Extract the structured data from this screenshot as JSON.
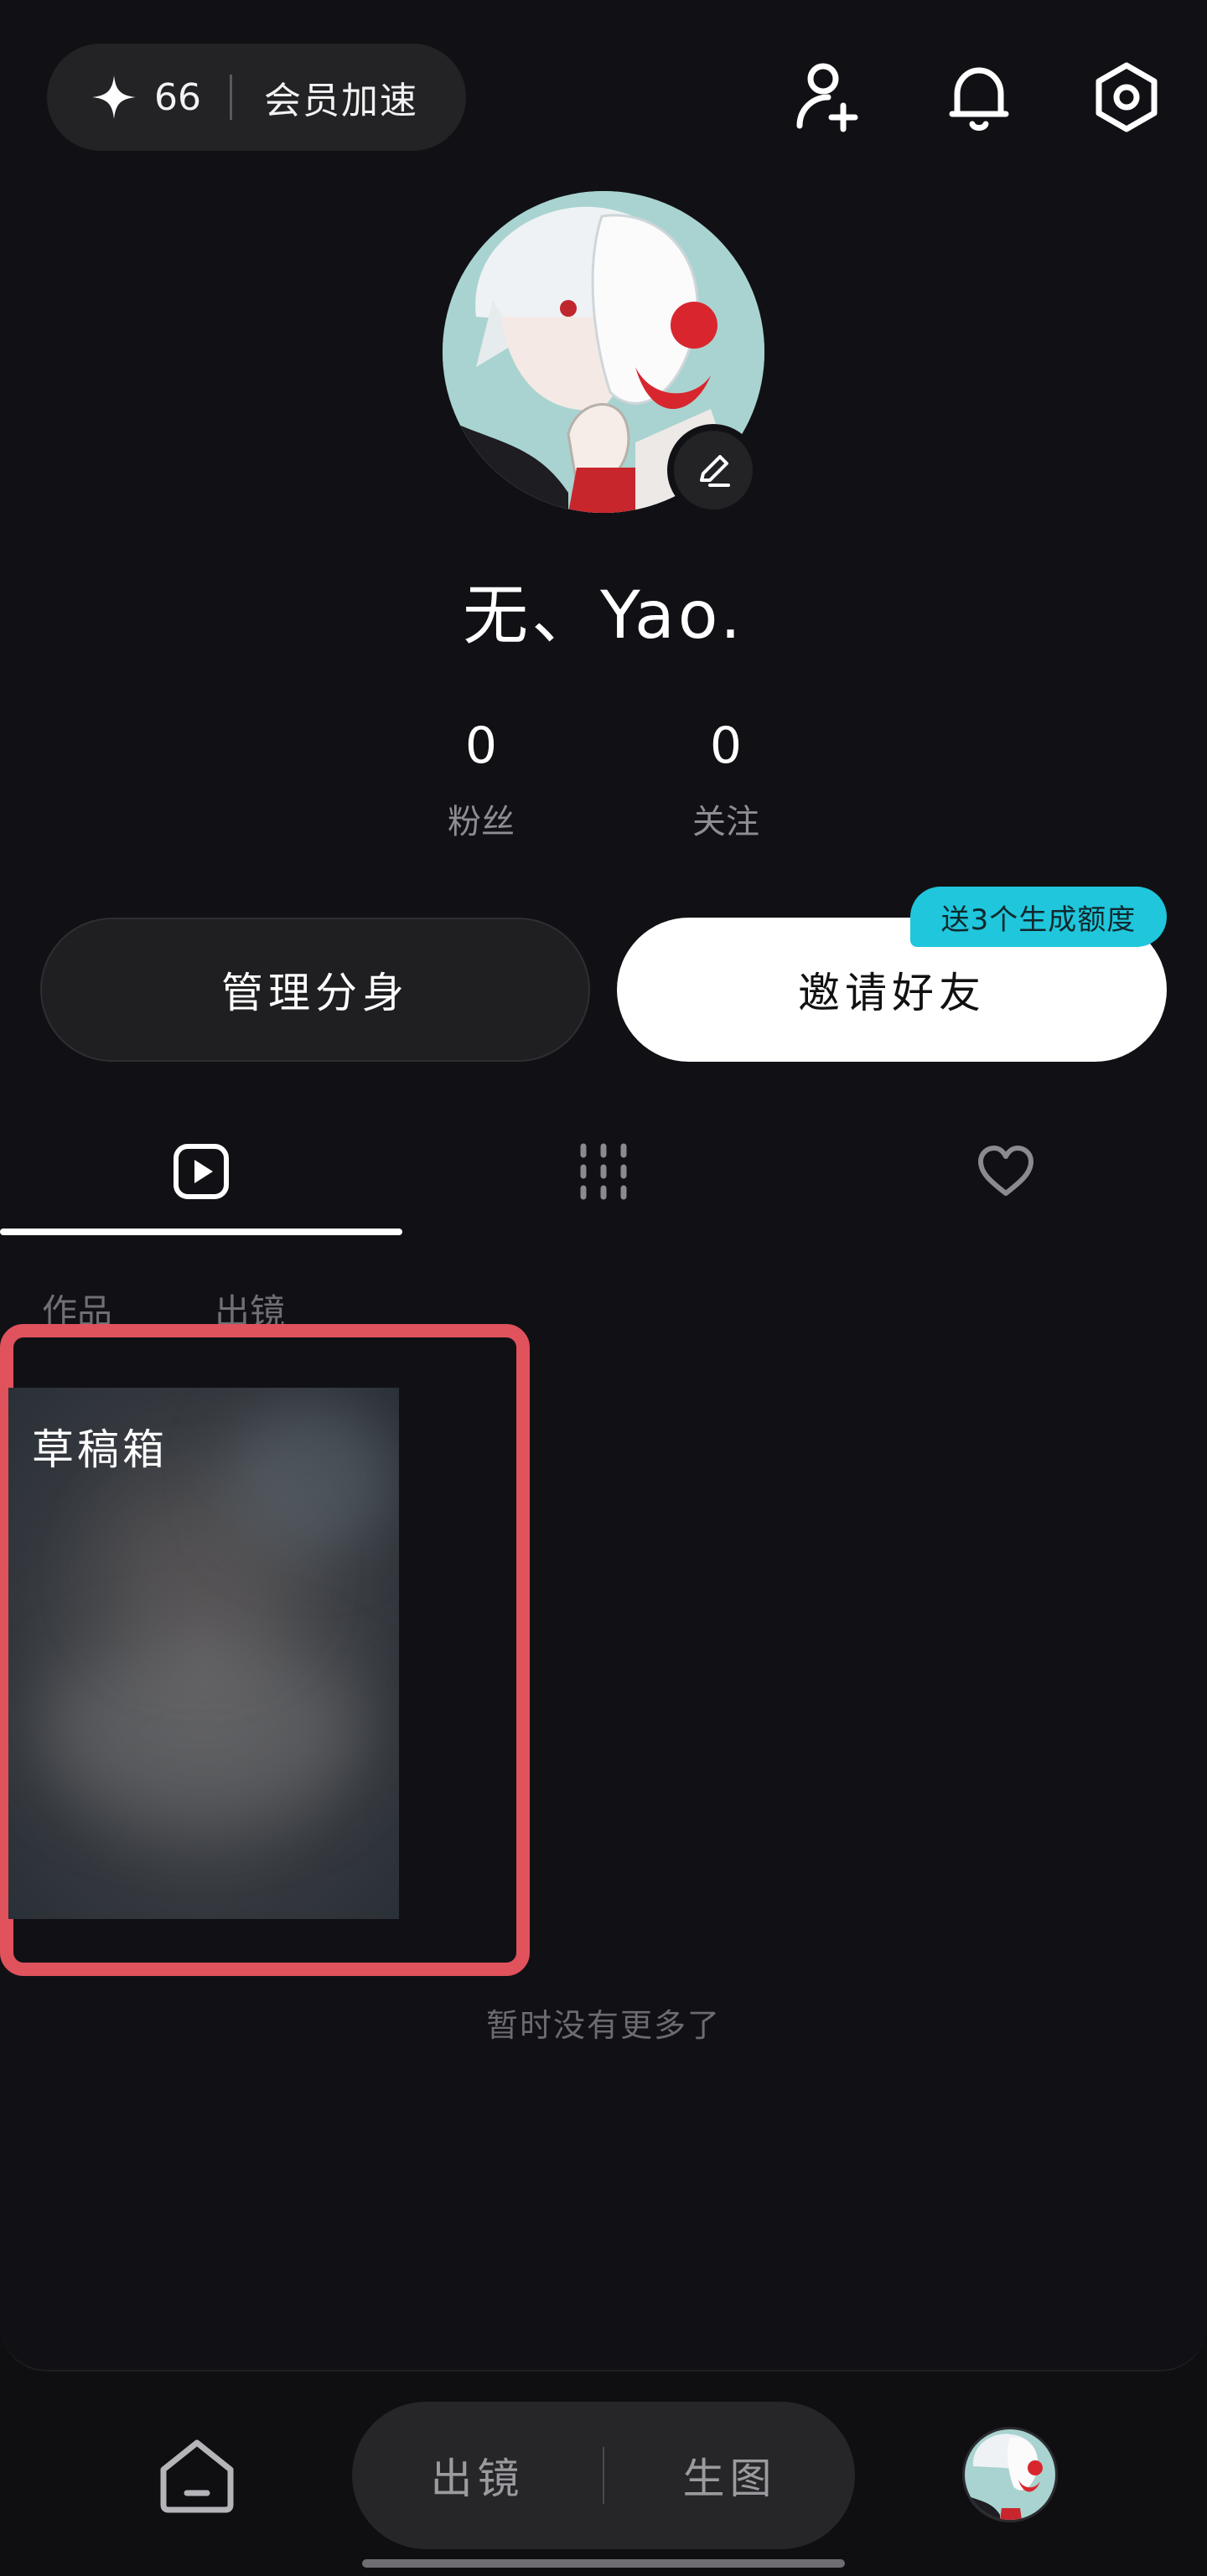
{
  "header": {
    "points_count": "66",
    "vip_label": "会员加速",
    "icons": [
      "star-icon",
      "add-friend-icon",
      "bell-icon",
      "settings-icon"
    ]
  },
  "profile": {
    "username": "无、Yao.",
    "followers_count": "0",
    "followers_label": "粉丝",
    "following_count": "0",
    "following_label": "关注"
  },
  "actions": {
    "manage_label": "管理分身",
    "invite_label": "邀请好友",
    "invite_badge": "送3个生成额度"
  },
  "tabs": [
    {
      "icon": "play-square-icon",
      "active": true
    },
    {
      "icon": "grid-icon",
      "active": false
    },
    {
      "icon": "heart-icon",
      "active": false
    }
  ],
  "subtabs": {
    "works": "作品",
    "appearance": "出镜"
  },
  "draft": {
    "label": "草稿箱"
  },
  "list_footer": "暂时没有更多了",
  "bottom_nav": {
    "home_icon": "home-icon",
    "appear_label": "出镜",
    "generate_label": "生图"
  },
  "colors": {
    "background": "#111115",
    "accent_badge": "#1fc6dc",
    "highlight_outline": "#e0525c",
    "invite_button": "#ffffff"
  }
}
